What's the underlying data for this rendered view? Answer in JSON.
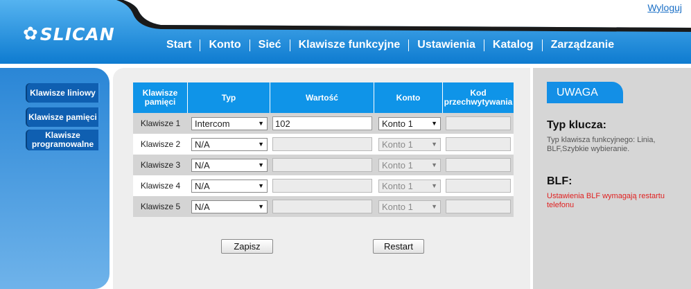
{
  "header": {
    "logo": "SLICAN",
    "logout": "Wyloguj",
    "nav": [
      "Start",
      "Konto",
      "Sieć",
      "Klawisze funkcyjne",
      "Ustawienia",
      "Katalog",
      "Zarządzanie"
    ]
  },
  "sidebar": {
    "items": [
      "Klawisze liniowy",
      "Klawisze pamięci",
      "Klawisze programowalne"
    ]
  },
  "table": {
    "headers": [
      "Klawisze pamięci",
      "Typ",
      "Wartość",
      "Konto",
      "Kod przechwytywania"
    ],
    "rows": [
      {
        "label": "Klawisze 1",
        "type": "Intercom",
        "value": "102",
        "account": "Konto 1",
        "code": ""
      },
      {
        "label": "Klawisze 2",
        "type": "N/A",
        "value": "",
        "account": "Konto 1",
        "code": ""
      },
      {
        "label": "Klawisze 3",
        "type": "N/A",
        "value": "",
        "account": "Konto 1",
        "code": ""
      },
      {
        "label": "Klawisze 4",
        "type": "N/A",
        "value": "",
        "account": "Konto 1",
        "code": ""
      },
      {
        "label": "Klawisze 5",
        "type": "N/A",
        "value": "",
        "account": "Konto 1",
        "code": ""
      }
    ]
  },
  "buttons": {
    "save": "Zapisz",
    "restart": "Restart"
  },
  "notes": {
    "header": "UWAGA",
    "title1": "Typ klucza:",
    "text1": "Typ klawisza funkcyjnego: Linia, BLF,Szybkie wybieranie.",
    "title2": "BLF:",
    "text2": "Ustawienia BLF wymagają restartu telefonu"
  },
  "colors": {
    "header_blue": "#1a8be0",
    "table_header": "#0f94e8",
    "warning_red": "#e02020",
    "dark_stripe": "#1a1a1a"
  }
}
